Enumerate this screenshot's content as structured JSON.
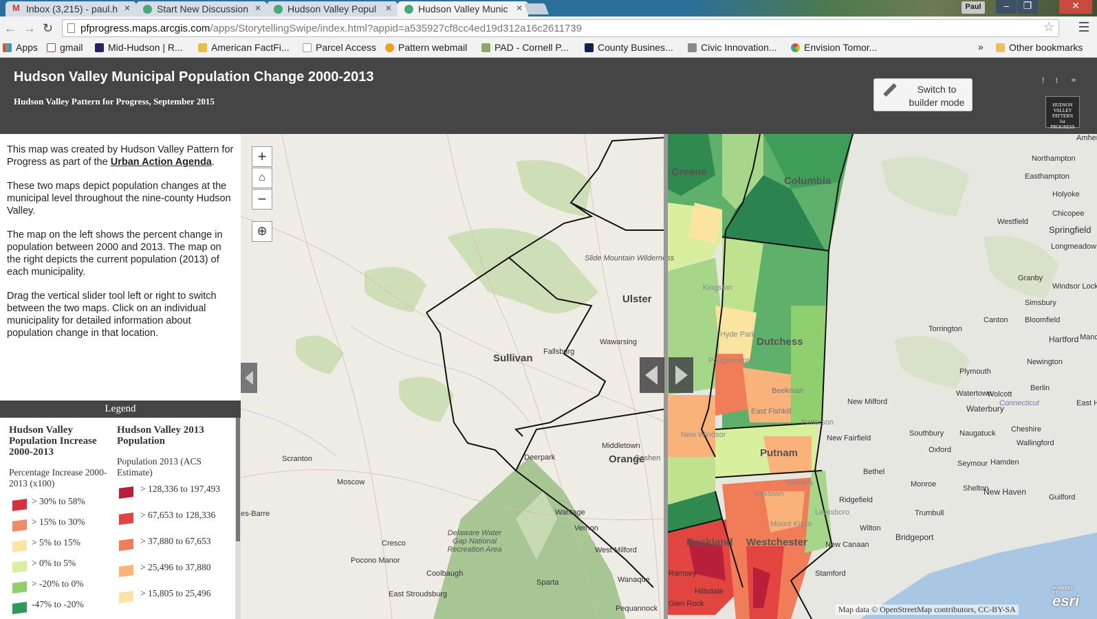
{
  "browser": {
    "tabs": [
      {
        "label": "Inbox (3,215) - paul.h",
        "icon": "gmail-icon"
      },
      {
        "label": "Start New Discussion",
        "icon": "globe-icon"
      },
      {
        "label": "Hudson Valley Popul",
        "icon": "globe-icon"
      },
      {
        "label": "Hudson Valley Munic",
        "icon": "globe-icon",
        "active": true
      }
    ],
    "user": "Paul",
    "url_host": "pfprogress.maps.arcgis.com",
    "url_path": "/apps/StorytellingSwipe/index.html?appid=a535927cf8cc4ed19d312a16c2611739",
    "bookmarks": [
      "Apps",
      "gmail",
      "Mid-Hudson | R...",
      "American FactFi...",
      "Parcel Access",
      "Pattern webmail",
      "PAD - Cornell P...",
      "County Busines...",
      "Civic Innovation...",
      "Envision Tomor..."
    ],
    "bookmarks_more": "»",
    "other_bookmarks": "Other bookmarks"
  },
  "header": {
    "title": "Hudson Valley Municipal Population Change 2000-2013",
    "subtitle": "Hudson Valley Pattern for Progress, September 2015",
    "builder_line1": "Switch to",
    "builder_line2": "builder mode",
    "logo_lines": [
      "HUDSON VALLEY",
      "PATTERN",
      "for",
      "PROGRESS"
    ]
  },
  "description": {
    "p1_text": "This map was created by Hudson Valley Pattern for Progress as part of the ",
    "p1_link": "Urban Action Agenda",
    "p1_end": ".",
    "p2": "These two maps depict population changes at the municipal level throughout the nine-county Hudson Valley.",
    "p3": "The map on the left shows the percent change in population between 2000 and 2013. The map on the right depicts the current population (2013) of each municipality.",
    "p4": "Drag the vertical slider tool left or right to switch between the two maps.  Click on an individual municipality for detailed information about population change in that location."
  },
  "legend": {
    "header": "Legend",
    "left": {
      "title": "Hudson Valley Population Increase 2000-2013",
      "subtitle": "Percentage Increase 2000-2013 (x100)",
      "items": [
        {
          "label": "> 30% to 58%",
          "color": "#d7303f"
        },
        {
          "label": "> 15% to 30%",
          "color": "#f08a6a"
        },
        {
          "label": "> 5% to 15%",
          "color": "#fbe3a0"
        },
        {
          "label": "> 0% to 5%",
          "color": "#d8ef9e"
        },
        {
          "label": "> -20% to 0%",
          "color": "#8fcf6e"
        },
        {
          "label": "-47% to -20%",
          "color": "#2e9a5a"
        }
      ]
    },
    "right": {
      "title": "Hudson Valley 2013 Population",
      "subtitle": "Population 2013 (ACS Estimate)",
      "items": [
        {
          "label": "> 128,336 to 197,493",
          "color": "#b8203a"
        },
        {
          "label": "> 67,653 to 128,336",
          "color": "#e2443f"
        },
        {
          "label": "> 37,880 to 67,653",
          "color": "#f17d58"
        },
        {
          "label": "> 25,496 to 37,880",
          "color": "#f9b27a"
        },
        {
          "label": "> 15,805 to 25,496",
          "color": "#fde3a3"
        }
      ]
    }
  },
  "map": {
    "zoom_in": "+",
    "zoom_out": "−",
    "labels_left": [
      "Sullivan",
      "Ulster",
      "Orange",
      "Slide Mountain Wilderness",
      "Wawarsing",
      "Fallsburg",
      "Middletown",
      "Deerpark",
      "Scranton",
      "Moscow",
      "Wantage",
      "Vernon",
      "Cresco",
      "Pocono Manor",
      "West Milford",
      "Delaware Water Gap National Recreation Area",
      "Coolbaugh",
      "East Stroudsburg",
      "Sparta",
      "Wanaque",
      "Pequannock",
      "es-Barre",
      "Goshen"
    ],
    "labels_right": [
      "Greene",
      "Columbia",
      "Dutchess",
      "Putnam",
      "Rockland",
      "Westchester",
      "Poughkeepsie",
      "Hyde Park",
      "Kingston",
      "Beekman",
      "East Fishkill",
      "New Windsor",
      "Patterson",
      "Somers",
      "Yorktown",
      "Mount Kisco",
      "Lewisboro",
      "Ramsey",
      "Glen Rock",
      "Hillsdale",
      "Stamford",
      "Amherst",
      "Northampton",
      "Easthampton",
      "Holyoke",
      "Chicopee",
      "Springfield",
      "Westfield",
      "Longmeadow",
      "Granby",
      "Windsor Locks",
      "Simsbury",
      "Canton",
      "Bloomfield",
      "Hartford",
      "Manchester",
      "Torrington",
      "Newington",
      "Plymouth",
      "Berlin",
      "Watertown",
      "Wolcott",
      "New Milford",
      "Waterbury",
      "Southbury",
      "Naugatuck",
      "Cheshire",
      "Wallingford",
      "New Fairfield",
      "Oxford",
      "Seymour",
      "Hamden",
      "Bethel",
      "Monroe",
      "Shelton",
      "New Haven",
      "Guilford",
      "Ridgefield",
      "Trumbull",
      "Wilton",
      "Bridgeport",
      "New Canaan",
      "Connecticut",
      "East Ham"
    ],
    "attribution": "Map data © OpenStreetMap contributors, CC-BY-SA",
    "esri_powered": "POWERED BY",
    "esri": "esri"
  }
}
